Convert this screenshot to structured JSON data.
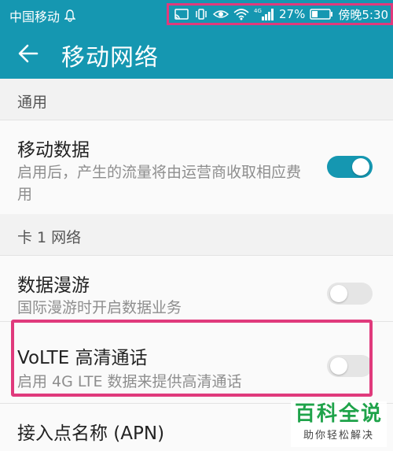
{
  "status_bar": {
    "carrier": "中国移动",
    "network_badge": "4G",
    "battery": "27%",
    "time": "傍晚5:30",
    "highlight_color": "#e03a7c"
  },
  "app_bar": {
    "title": "移动网络",
    "back_icon": "arrow-left-icon",
    "color": "#1597b1"
  },
  "sections": {
    "general": {
      "header": "通用"
    },
    "sim1": {
      "header": "卡 1 网络"
    }
  },
  "items": {
    "mobile_data": {
      "title": "移动数据",
      "subtitle": "启用后，产生的流量将由运营商收取相应费用",
      "enabled": true
    },
    "data_roaming": {
      "title": "数据漫游",
      "subtitle": "国际漫游时开启数据业务",
      "enabled": false
    },
    "volte": {
      "title": "VoLTE 高清通话",
      "subtitle": "启用 4G LTE 数据来提供高清通话",
      "enabled": false
    },
    "apn": {
      "title": "接入点名称 (APN)"
    }
  },
  "watermark": {
    "title": "百科全说",
    "subtitle": "助你轻松解决",
    "color": "#1fa34a"
  }
}
